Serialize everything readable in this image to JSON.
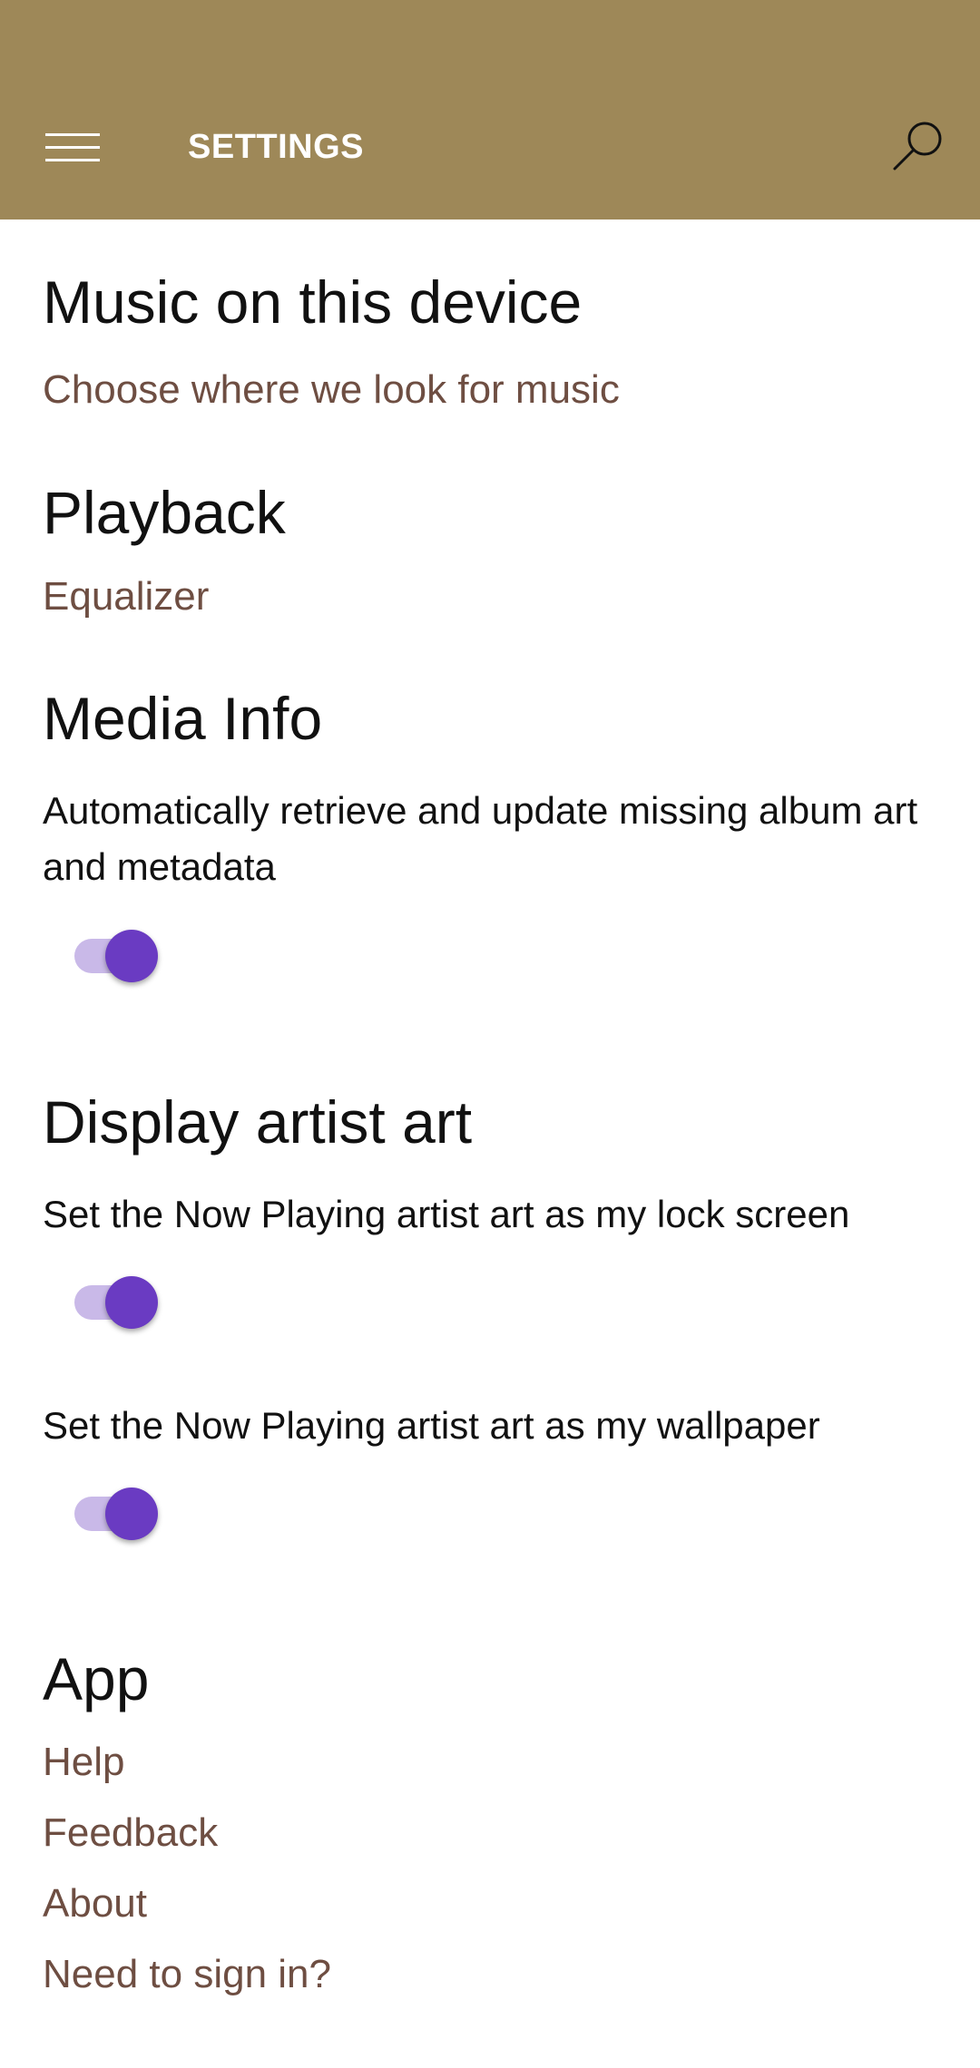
{
  "header": {
    "title": "SETTINGS",
    "menu_icon": "hamburger-menu-icon",
    "search_icon": "search-icon",
    "background_color": "#9e8858"
  },
  "sections": {
    "music": {
      "title": "Music on this device",
      "link": "Choose where we look for music"
    },
    "playback": {
      "title": "Playback",
      "link": "Equalizer"
    },
    "media_info": {
      "title": "Media Info",
      "description": "Automatically retrieve and update missing album art and metadata",
      "toggle_on": true
    },
    "artist_art": {
      "title": "Display artist art",
      "lock_screen_label": "Set the Now Playing artist art as my lock screen",
      "lock_screen_on": true,
      "wallpaper_label": "Set the Now Playing artist art as my wallpaper",
      "wallpaper_on": true
    },
    "app": {
      "title": "App",
      "links": [
        "Help",
        "Feedback",
        "About",
        "Need to sign in?"
      ]
    }
  },
  "colors": {
    "link": "#6e4e42",
    "toggle_accent": "#6a3bc2",
    "toggle_track": "#c9b9e8"
  }
}
